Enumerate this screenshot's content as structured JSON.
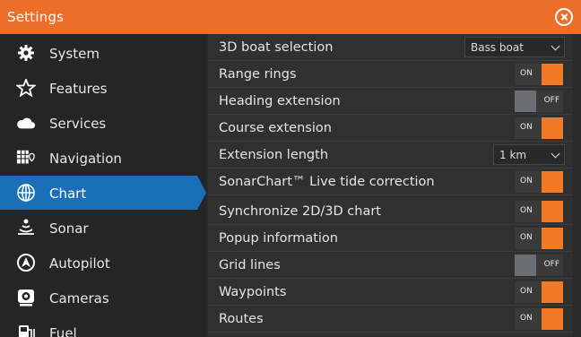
{
  "window": {
    "title": "Settings",
    "close_icon": "close-circle-icon"
  },
  "sidebar": {
    "active_color": "#1b6fb8",
    "items": [
      {
        "label": "System",
        "icon": "gear-icon",
        "active": false
      },
      {
        "label": "Features",
        "icon": "star-icon",
        "active": false
      },
      {
        "label": "Services",
        "icon": "cloud-icon",
        "active": false
      },
      {
        "label": "Navigation",
        "icon": "navigation-icon",
        "active": false
      },
      {
        "label": "Chart",
        "icon": "globe-icon",
        "active": true
      },
      {
        "label": "Sonar",
        "icon": "sonar-icon",
        "active": false
      },
      {
        "label": "Autopilot",
        "icon": "autopilot-icon",
        "active": false
      },
      {
        "label": "Cameras",
        "icon": "camera-icon",
        "active": false
      },
      {
        "label": "Fuel",
        "icon": "fuel-pump-icon",
        "active": false
      }
    ]
  },
  "settings": {
    "accent_color": "#f07a26",
    "rows": [
      {
        "label": "3D boat selection",
        "control": "dropdown",
        "value": "Bass boat"
      },
      {
        "label": "Range rings",
        "control": "toggle",
        "state": "ON"
      },
      {
        "label": "Heading extension",
        "control": "toggle",
        "state": "OFF"
      },
      {
        "label": "Course extension",
        "control": "toggle",
        "state": "ON"
      },
      {
        "label": "Extension length",
        "control": "dropdown",
        "value": "1 km"
      },
      {
        "label": "SonarChart™ Live tide correction",
        "control": "toggle",
        "state": "ON"
      },
      {
        "label": "Synchronize 2D/3D chart",
        "control": "toggle",
        "state": "ON"
      },
      {
        "label": "Popup information",
        "control": "toggle",
        "state": "ON"
      },
      {
        "label": "Grid lines",
        "control": "toggle",
        "state": "OFF"
      },
      {
        "label": "Waypoints",
        "control": "toggle",
        "state": "ON"
      },
      {
        "label": "Routes",
        "control": "toggle",
        "state": "ON"
      }
    ]
  }
}
